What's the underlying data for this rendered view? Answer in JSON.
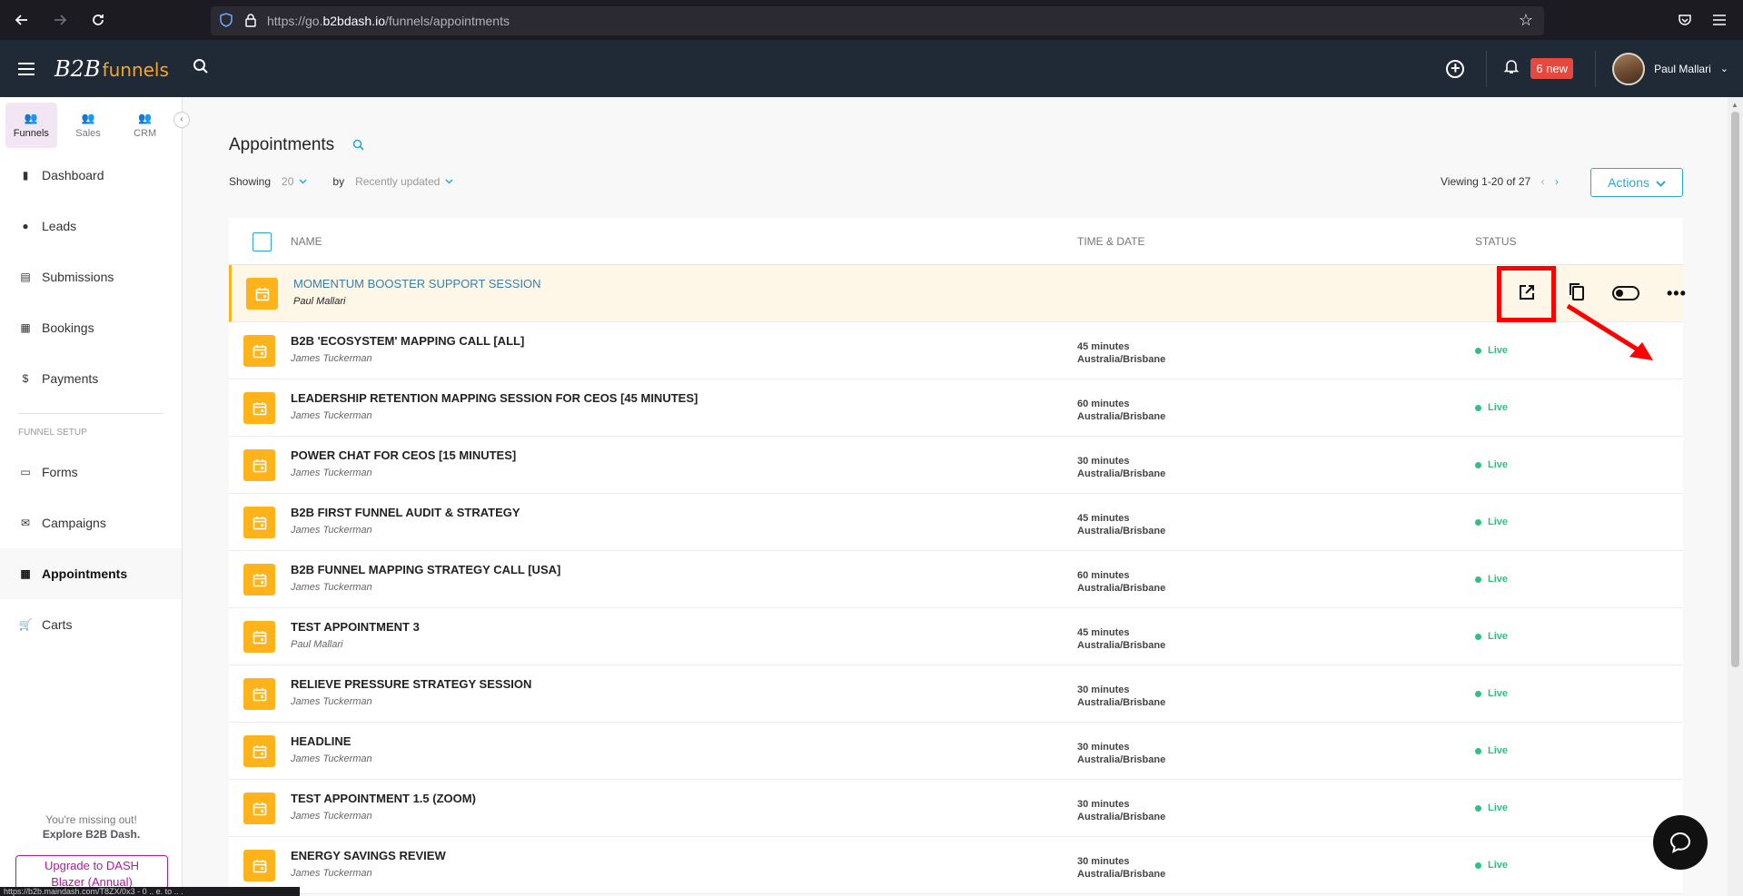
{
  "browser": {
    "url_prefix": "https://go.",
    "url_domain": "b2bdash.io",
    "url_path": "/funnels/appointments",
    "status_url": "https://b2b.maindash.com/T8ZX/0x3 - 0 .. e. to .. ."
  },
  "header": {
    "logo_text": "B2B",
    "logo_accent": "funnels",
    "notifications_badge": "6 new",
    "user_name": "Paul Mallari"
  },
  "sidebar": {
    "tabs": [
      {
        "label": "Funnels",
        "icon": "people-icon",
        "active": true
      },
      {
        "label": "Sales",
        "icon": "people-icon",
        "active": false
      },
      {
        "label": "CRM",
        "icon": "people-icon",
        "active": false
      }
    ],
    "items": [
      {
        "label": "Dashboard",
        "icon": "bar-chart-icon"
      },
      {
        "label": "Leads",
        "icon": "location-pin-icon"
      },
      {
        "label": "Submissions",
        "icon": "clipboard-icon"
      },
      {
        "label": "Bookings",
        "icon": "calendar-icon"
      },
      {
        "label": "Payments",
        "icon": "dollar-icon"
      }
    ],
    "section_label": "FUNNEL SETUP",
    "setup_items": [
      {
        "label": "Forms",
        "icon": "form-icon"
      },
      {
        "label": "Campaigns",
        "icon": "mail-icon"
      },
      {
        "label": "Appointments",
        "icon": "calendar-icon",
        "active": true
      },
      {
        "label": "Carts",
        "icon": "cart-icon"
      }
    ],
    "promo_line1": "You're missing out!",
    "promo_line2": "Explore B2B Dash.",
    "upgrade_line1": "Upgrade to DASH",
    "upgrade_line2": "Blazer (Annual)"
  },
  "page": {
    "title": "Appointments",
    "showing_label": "Showing",
    "showing_value": "20",
    "by_label": "by",
    "sort_value": "Recently updated",
    "viewing_text": "Viewing 1-20 of 27",
    "actions_label": "Actions"
  },
  "table": {
    "headers": {
      "name": "NAME",
      "time": "TIME & DATE",
      "status": "STATUS"
    },
    "rows": [
      {
        "title": "MOMENTUM BOOSTER SUPPORT SESSION",
        "owner": "Paul Mallari",
        "duration": "",
        "timezone": "",
        "status": "",
        "highlighted": true
      },
      {
        "title": "B2B 'ECOSYSTEM' MAPPING CALL [ALL]",
        "owner": "James Tuckerman",
        "duration": "45 minutes",
        "timezone": "Australia/Brisbane",
        "status": "Live"
      },
      {
        "title": "LEADERSHIP RETENTION MAPPING SESSION FOR CEOS [45 MINUTES]",
        "owner": "James Tuckerman",
        "duration": "60 minutes",
        "timezone": "Australia/Brisbane",
        "status": "Live"
      },
      {
        "title": "POWER CHAT FOR CEOS [15 MINUTES]",
        "owner": "James Tuckerman",
        "duration": "30 minutes",
        "timezone": "Australia/Brisbane",
        "status": "Live"
      },
      {
        "title": "B2B FIRST FUNNEL AUDIT & STRATEGY",
        "owner": "James Tuckerman",
        "duration": "45 minutes",
        "timezone": "Australia/Brisbane",
        "status": "Live"
      },
      {
        "title": "B2B FUNNEL MAPPING STRATEGY CALL [USA]",
        "owner": "James Tuckerman",
        "duration": "60 minutes",
        "timezone": "Australia/Brisbane",
        "status": "Live"
      },
      {
        "title": "TEST APPOINTMENT 3",
        "owner": "Paul Mallari",
        "duration": "45 minutes",
        "timezone": "Australia/Brisbane",
        "status": "Live"
      },
      {
        "title": "RELIEVE PRESSURE STRATEGY SESSION",
        "owner": "James Tuckerman",
        "duration": "30 minutes",
        "timezone": "Australia/Brisbane",
        "status": "Live"
      },
      {
        "title": "HEADLINE",
        "owner": "James Tuckerman",
        "duration": "30 minutes",
        "timezone": "Australia/Brisbane",
        "status": "Live"
      },
      {
        "title": "TEST APPOINTMENT 1.5 (ZOOM)",
        "owner": "James Tuckerman",
        "duration": "30 minutes",
        "timezone": "Australia/Brisbane",
        "status": "Live"
      },
      {
        "title": "ENERGY SAVINGS REVIEW",
        "owner": "James Tuckerman",
        "duration": "30 minutes",
        "timezone": "Australia/Brisbane",
        "status": "Live"
      }
    ]
  },
  "colors": {
    "brand_accent": "#ffb31a",
    "link_blue": "#2aa8d8",
    "live_green": "#2ec27e",
    "highlight_red": "#ff0000",
    "header_bg": "#1f2a36"
  }
}
